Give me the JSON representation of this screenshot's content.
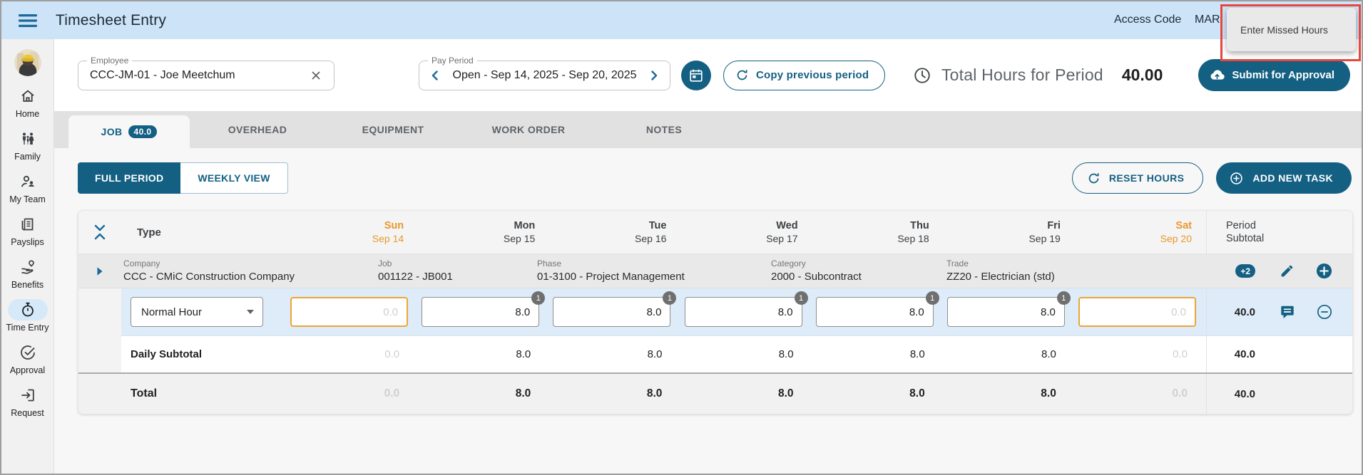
{
  "app": {
    "title": "Timesheet Entry",
    "access_code_label": "Access Code",
    "access_code_value": "MAR",
    "missed_hours_tooltip": "Enter Missed Hours"
  },
  "colors": {
    "primary": "#146083",
    "weekend_accent": "#e8982c",
    "entry_row_highlight": "#ddecf8",
    "annotation_red": "#e8463d",
    "appbar_blue": "#cce3f8"
  },
  "sidebar": {
    "active_item": "Time Entry",
    "items": [
      {
        "label": "Home"
      },
      {
        "label": "Family"
      },
      {
        "label": "My Team"
      },
      {
        "label": "Payslips"
      },
      {
        "label": "Benefits"
      },
      {
        "label": "Time Entry"
      },
      {
        "label": "Approval"
      },
      {
        "label": "Request"
      }
    ]
  },
  "toolbar": {
    "employee_label": "Employee",
    "employee_value": "CCC-JM-01 - Joe Meetchum",
    "pay_period_label": "Pay Period",
    "pay_period_value": "Open - Sep 14, 2025 - Sep 20, 2025",
    "copy_previous_label": "Copy previous period",
    "total_hours_label": "Total Hours for Period",
    "total_hours_value": "40.00",
    "submit_label": "Submit for Approval"
  },
  "tabs": {
    "job": "JOB",
    "job_badge": "40.0",
    "overhead": "OVERHEAD",
    "equipment": "EQUIPMENT",
    "work_order": "WORK ORDER",
    "notes": "NOTES",
    "active": "JOB"
  },
  "view_toggle": {
    "full_period": "FULL PERIOD",
    "weekly_view": "WEEKLY VIEW",
    "active": "FULL PERIOD"
  },
  "table_actions": {
    "reset": "RESET HOURS",
    "add": "ADD NEW TASK"
  },
  "timesheet": {
    "type_header": "Type",
    "days": [
      {
        "name": "Sun",
        "date": "Sep 14"
      },
      {
        "name": "Mon",
        "date": "Sep 15"
      },
      {
        "name": "Tue",
        "date": "Sep 16"
      },
      {
        "name": "Wed",
        "date": "Sep 17"
      },
      {
        "name": "Thu",
        "date": "Sep 18"
      },
      {
        "name": "Fri",
        "date": "Sep 19"
      },
      {
        "name": "Sat",
        "date": "Sep 20"
      }
    ],
    "period_header_line1": "Period",
    "period_header_line2": "Subtotal",
    "task": {
      "company_label": "Company",
      "company": "CCC - CMiC Construction Company",
      "job_label": "Job",
      "job": "001122 - JB001",
      "phase_label": "Phase",
      "phase": "01-3100 - Project Management",
      "category_label": "Category",
      "category": "2000 - Subcontract",
      "trade_label": "Trade",
      "trade": "ZZ20 - Electrician (std)",
      "more_badge": "+2",
      "hour_type": "Normal Hour",
      "cells": [
        {
          "value": "",
          "placeholder": "0.0"
        },
        {
          "value": "8.0",
          "badge": "1"
        },
        {
          "value": "8.0",
          "badge": "1"
        },
        {
          "value": "8.0",
          "badge": "1"
        },
        {
          "value": "8.0",
          "badge": "1"
        },
        {
          "value": "8.0",
          "badge": "1"
        },
        {
          "value": "",
          "placeholder": "0.0"
        }
      ],
      "period_subtotal": "40.0"
    },
    "daily_subtotal": {
      "label": "Daily Subtotal",
      "values": [
        "0.0",
        "8.0",
        "8.0",
        "8.0",
        "8.0",
        "8.0",
        "0.0"
      ],
      "period": "40.0"
    },
    "total": {
      "label": "Total",
      "values": [
        "0.0",
        "8.0",
        "8.0",
        "8.0",
        "8.0",
        "8.0",
        "0.0"
      ],
      "period": "40.0"
    }
  }
}
